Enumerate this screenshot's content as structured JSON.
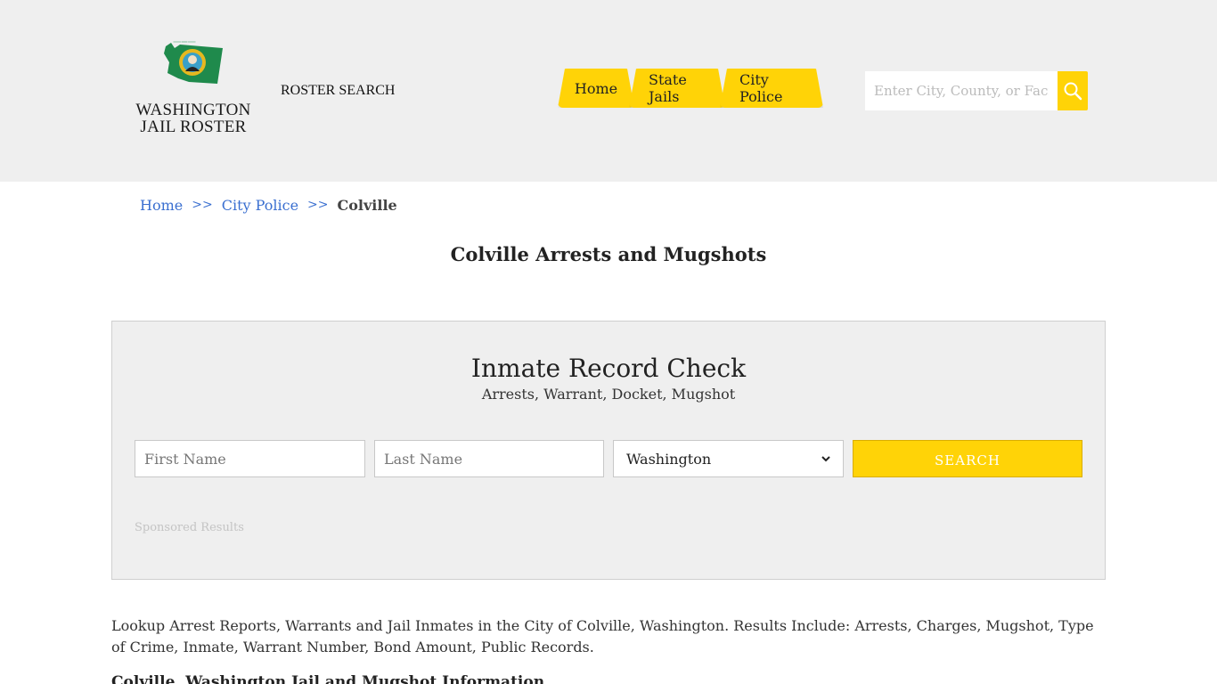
{
  "header": {
    "logo": {
      "line1": "WASHINGTON",
      "line2": "JAIL ROSTER",
      "icon": "washington-state-seal-icon"
    },
    "roster_search_label": "ROSTER SEARCH",
    "nav": [
      {
        "label": "Home"
      },
      {
        "label": "State Jails"
      },
      {
        "label": "City Police"
      }
    ],
    "search": {
      "placeholder": "Enter City, County, or Facility",
      "icon": "search-icon"
    }
  },
  "breadcrumb": {
    "items": [
      {
        "label": "Home"
      },
      {
        "label": "City Police"
      },
      {
        "label": "Colville"
      }
    ],
    "separator": ">>"
  },
  "page_title": "Colville Arrests and Mugshots",
  "record_check": {
    "title": "Inmate Record Check",
    "subtitle": "Arrests, Warrant, Docket, Mugshot",
    "first_name_placeholder": "First Name",
    "last_name_placeholder": "Last Name",
    "state_selected": "Washington",
    "search_label": "SEARCH",
    "sponsored_label": "Sponsored Results"
  },
  "content": {
    "description": "Lookup Arrest Reports, Warrants and Jail Inmates in the City of Colville, Washington. Results Include: Arrests, Charges, Mugshot, Type of Crime, Inmate, Warrant Number, Bond Amount, Public Records.",
    "sub_heading": "Colville, Washington Jail and Mugshot Information"
  },
  "colors": {
    "accent": "#ffd307",
    "header_bg": "#efefef",
    "link": "#3a6fd0",
    "logo_green": "#1f8a4c"
  }
}
